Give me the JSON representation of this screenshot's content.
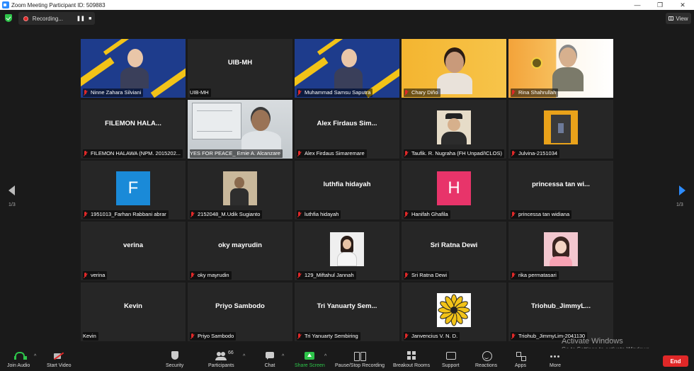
{
  "window": {
    "title": "Zoom Meeting Participant ID: 509883"
  },
  "recording": {
    "label": "Recording..."
  },
  "view": {
    "label": "View"
  },
  "pages": {
    "left": "1/3",
    "right": "1/3"
  },
  "tiles": [
    {
      "name": "Ninne Zahara Silviani",
      "big": "",
      "kind": "banner",
      "muted": true
    },
    {
      "name": "UIB-MH",
      "big": "UIB-MH",
      "kind": "text",
      "muted": false
    },
    {
      "name": "Muhammad Samsu Saputra",
      "big": "",
      "kind": "banner",
      "muted": true,
      "active": true
    },
    {
      "name": "Chary Diño",
      "big": "",
      "kind": "orange",
      "muted": true
    },
    {
      "name": "Rina Shahrullah",
      "big": "",
      "kind": "orange2",
      "muted": true
    },
    {
      "name": "FILEMON HALAWA (NPM. 2015202...",
      "big": "FILEMON HALA...",
      "kind": "text",
      "muted": true
    },
    {
      "name": "YES FOR PEACE_ Ernie A. Alcanzare",
      "big": "",
      "kind": "photo",
      "muted": false
    },
    {
      "name": "Alex Firdaus Simaremare",
      "big": "Alex Firdaus Sim...",
      "kind": "text",
      "muted": true
    },
    {
      "name": "Taufik. R. Nugraha (FH Unpad/ICLOS)",
      "big": "",
      "kind": "avatar-man",
      "muted": true
    },
    {
      "name": "Julvina-2151034",
      "big": "",
      "kind": "avatar-door",
      "muted": true
    },
    {
      "name": "1951013_Farhan Rabbani abrar",
      "big": "",
      "kind": "initial",
      "initial": "F",
      "color": "#1a8ad8",
      "muted": true
    },
    {
      "name": "2152048_M.Udik Sugianto",
      "big": "",
      "kind": "avatar-room",
      "muted": true
    },
    {
      "name": "luthfia hidayah",
      "big": "luthfia hidayah",
      "kind": "text",
      "muted": true
    },
    {
      "name": "Hanifah Ghafila",
      "big": "",
      "kind": "initial",
      "initial": "H",
      "color": "#e8346a",
      "muted": true
    },
    {
      "name": "princessa tan widiana",
      "big": "princessa tan wi...",
      "kind": "text",
      "muted": true
    },
    {
      "name": "verina",
      "big": "verina",
      "kind": "text",
      "muted": true
    },
    {
      "name": "oky mayrudin",
      "big": "oky mayrudin",
      "kind": "text",
      "muted": true
    },
    {
      "name": "129_Miftahul Jannah",
      "big": "",
      "kind": "avatar-woman",
      "muted": true
    },
    {
      "name": "Sri Ratna Dewi",
      "big": "Sri Ratna Dewi",
      "kind": "text",
      "muted": true
    },
    {
      "name": "rika permatasari",
      "big": "",
      "kind": "avatar-pink",
      "muted": true
    },
    {
      "name": "Kevin",
      "big": "Kevin",
      "kind": "text",
      "muted": false
    },
    {
      "name": "Priyo Sambodo",
      "big": "Priyo Sambodo",
      "kind": "text",
      "muted": true
    },
    {
      "name": "Tri Yanuarty Sembiring",
      "big": "Tri Yanuarty Sem...",
      "kind": "text",
      "muted": true
    },
    {
      "name": "Janvencius V. N. D.",
      "big": "",
      "kind": "avatar-flower",
      "muted": true
    },
    {
      "name": "Triohub_JimmyLim-2041130",
      "big": "Triohub_JimmyL...",
      "kind": "text",
      "muted": true
    }
  ],
  "toolbar": {
    "join_audio": "Join Audio",
    "start_video": "Start Video",
    "security": "Security",
    "participants": "Participants",
    "participants_count": "66",
    "chat": "Chat",
    "share_screen": "Share Screen",
    "record": "Pause/Stop Recording",
    "breakout": "Breakout Rooms",
    "support": "Support",
    "reactions": "Reactions",
    "apps": "Apps",
    "more": "More",
    "end": "End"
  },
  "watermark": {
    "line1": "Activate Windows",
    "line2": "Go to Settings to activate Windows."
  },
  "colors": {
    "accent": "#2d8cff",
    "active_speaker": "#d4e045",
    "end": "#e02828",
    "share": "#2ec44a"
  }
}
